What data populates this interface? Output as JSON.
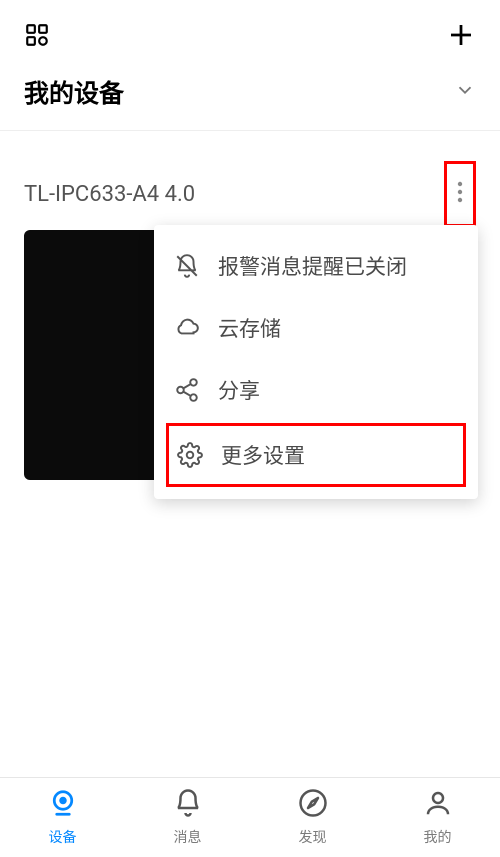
{
  "section_title": "我的设备",
  "device": {
    "name": "TL-IPC633-A4 4.0"
  },
  "popup": {
    "alarm_label": "报警消息提醒已关闭",
    "cloud_label": "云存储",
    "share_label": "分享",
    "more_settings_label": "更多设置"
  },
  "nav": {
    "devices_label": "设备",
    "messages_label": "消息",
    "discover_label": "发现",
    "mine_label": "我的"
  }
}
